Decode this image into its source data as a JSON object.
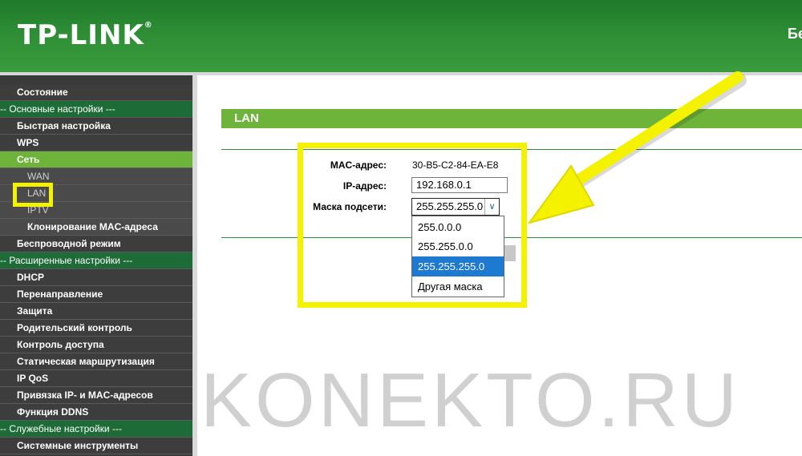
{
  "header": {
    "logo": "TP-LINK",
    "logo_mark": "®",
    "right_text": "Бе"
  },
  "sidebar": {
    "items": [
      {
        "label": "Состояние",
        "kind": "item"
      },
      {
        "label": "-- Основные настройки ---",
        "kind": "section"
      },
      {
        "label": "Быстрая настройка",
        "kind": "item"
      },
      {
        "label": "WPS",
        "kind": "item"
      },
      {
        "label": "Сеть",
        "kind": "active"
      },
      {
        "label": "WAN",
        "kind": "sub"
      },
      {
        "label": "LAN",
        "kind": "sub"
      },
      {
        "label": "IPTV",
        "kind": "sub"
      },
      {
        "label": "Клонирование MAC-адреса",
        "kind": "sub-strong"
      },
      {
        "label": "Беспроводной режим",
        "kind": "item"
      },
      {
        "label": "-- Расширенные настройки ---",
        "kind": "section"
      },
      {
        "label": "DHCP",
        "kind": "item"
      },
      {
        "label": "Перенаправление",
        "kind": "item"
      },
      {
        "label": "Защита",
        "kind": "item"
      },
      {
        "label": "Родительский контроль",
        "kind": "item"
      },
      {
        "label": "Контроль доступа",
        "kind": "item"
      },
      {
        "label": "Статическая маршрутизация",
        "kind": "item"
      },
      {
        "label": "IP QoS",
        "kind": "item"
      },
      {
        "label": "Привязка IP- и MAC-адресов",
        "kind": "item"
      },
      {
        "label": "Функция DDNS",
        "kind": "item"
      },
      {
        "label": "-- Служебные настройки ---",
        "kind": "section"
      },
      {
        "label": "Системные инструменты",
        "kind": "item"
      }
    ]
  },
  "main": {
    "section_title": "LAN",
    "mac_label": "MAC-адрес:",
    "mac_value": "30-B5-C2-84-EA-E8",
    "ip_label": "IP-адрес:",
    "ip_value": "192.168.0.1",
    "mask_label": "Маска подсети:",
    "mask_value": "255.255.255.0",
    "mask_options": [
      "255.0.0.0",
      "255.255.0.0",
      "255.255.255.0",
      "Другая маска"
    ],
    "mask_selected_index": 2
  },
  "watermark": "KONEKTO.RU",
  "colors": {
    "header_green": "#2f8f36",
    "sidebar_dark": "#3d3d3d",
    "section_green": "#1d6b36",
    "active_green": "#6fb43a",
    "highlight_yellow": "#f5f200",
    "selected_blue": "#1e7ad1"
  }
}
